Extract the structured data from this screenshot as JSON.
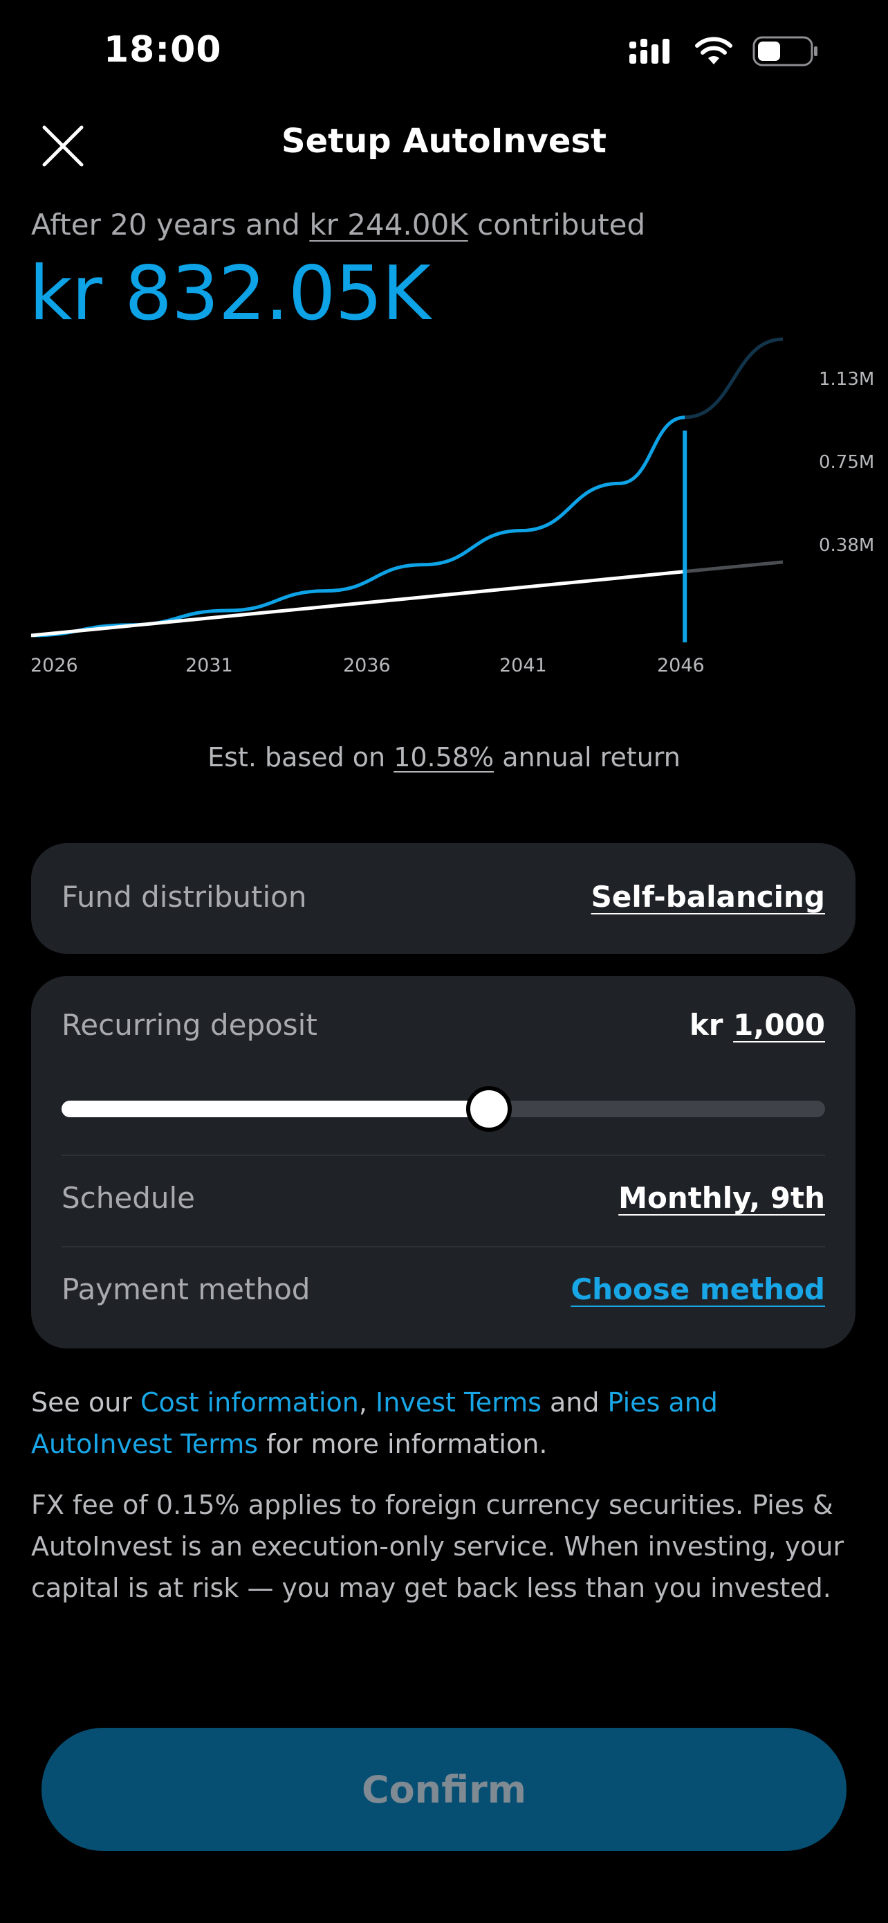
{
  "status_bar": {
    "time": "18:00"
  },
  "header": {
    "title": "Setup AutoInvest",
    "close_icon": "close-icon"
  },
  "summary": {
    "prefix": "After 20 years and ",
    "contributed": "kr 244.00K",
    "suffix": " contributed",
    "projected_value": "kr 832.05K"
  },
  "chart_data": {
    "type": "line",
    "x_tick_labels": [
      "2026",
      "2031",
      "2036",
      "2041",
      "2046"
    ],
    "y_tick_labels": [
      "1.13M",
      "0.75M",
      "0.38M"
    ],
    "marker_year": 2046,
    "series": [
      {
        "color": "#0ea3e6",
        "x": [
          2026,
          2029,
          2032,
          2035,
          2038,
          2041,
          2044,
          2046,
          2049
        ],
        "y": [
          0,
          40,
          95,
          170,
          270,
          400,
          580,
          832,
          1130
        ]
      },
      {
        "color": "#ffffff",
        "x": [
          2026,
          2046,
          2049
        ],
        "y": [
          0,
          244,
          280
        ]
      }
    ],
    "colors": {
      "projection": "#0ea3e6",
      "contributions": "#ffffff",
      "future": "#4a4d52"
    }
  },
  "estimate": {
    "prefix": "Est. based on ",
    "rate": "10.58%",
    "suffix": " annual return"
  },
  "fund_distribution": {
    "label": "Fund distribution",
    "value": "Self-balancing"
  },
  "recurring_deposit": {
    "label": "Recurring deposit",
    "currency": "kr ",
    "amount": "1,000",
    "slider_level": 0.56
  },
  "schedule": {
    "label": "Schedule",
    "value": "Monthly, 9th"
  },
  "payment_method": {
    "label": "Payment method",
    "value": "Choose method"
  },
  "info": {
    "see_our": "See our ",
    "cost_info": "Cost information",
    "comma": ", ",
    "invest_terms": "Invest Terms",
    "and": " and ",
    "pies_terms": "Pies and AutoInvest Terms",
    "more_info": " for more information.",
    "disclaimer": "FX fee of 0.15% applies to foreign currency securities. Pies & AutoInvest is an execution-only service. When investing, your capital is at risk — you may get back less than you invested."
  },
  "confirm_label": "Confirm"
}
